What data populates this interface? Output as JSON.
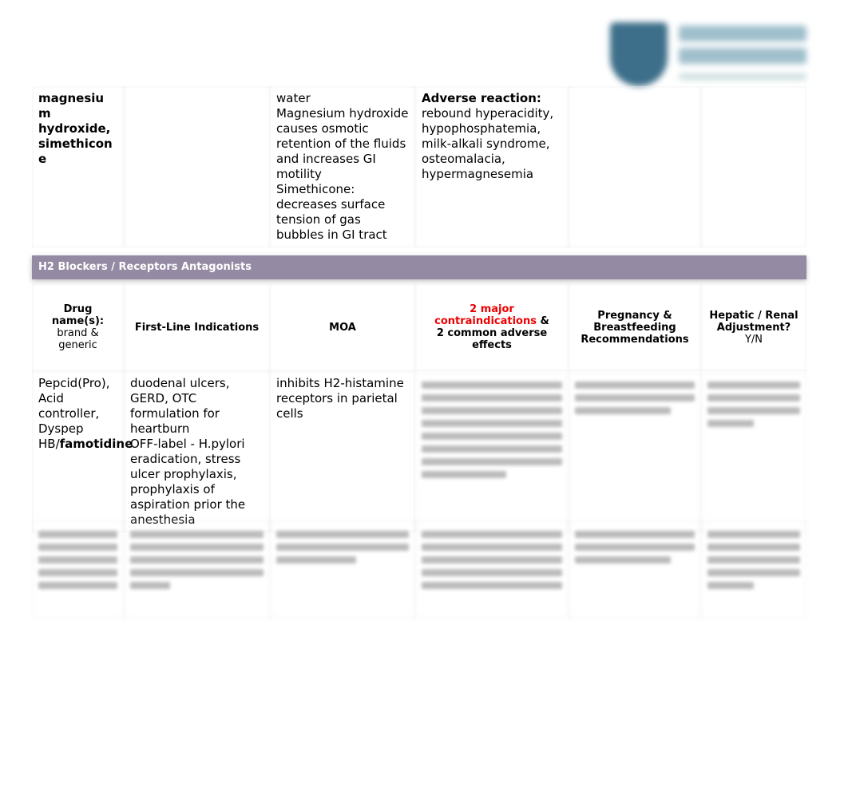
{
  "logo": {
    "icon": "shield-logo",
    "color": "#3d6f8a"
  },
  "row_top": {
    "drug": [
      "magnesiu",
      "m",
      "hydroxide,",
      "simethicon",
      "e"
    ],
    "moa": "water\nMagnesium hydroxide causes osmotic retention of the fluids and increases GI motility\nSimethicone: decreases surface tension of gas bubbles in GI  tract",
    "adverse_label": "Adverse reaction:",
    "adverse": "rebound hyperacidity, hypophosphatemia, milk-alkali syndrome, osteomalacia, hypermagnesemia"
  },
  "section": {
    "title": "H2 Blockers / Receptors Antagonists",
    "color": "#958aa3"
  },
  "headers": {
    "drug_bold": "Drug name(s):",
    "drug_sub": "brand & generic",
    "indications": "First-Line Indications",
    "moa": "MOA",
    "contra_red": "2 major contraindications",
    "contra_amp": " &",
    "contra_rest": "2 common adverse effects",
    "pregnancy": "Pregnancy & Breastfeeding Recommendations",
    "hepatic_bold": "Hepatic / Renal Adjustment?",
    "hepatic_sub": "Y/N"
  },
  "row_pepcid": {
    "drug_plain": "Pepcid(Pro), Acid controller, Dyspep HB/",
    "drug_bold": "famotidine",
    "indications": "duodenal ulcers, GERD, OTC formulation for heartburn\nOFF-label - H.pylori eradication, stress ulcer prophylaxis, prophylaxis of aspiration prior the anesthesia",
    "moa": "inhibits H2-histamine receptors in parietal cells"
  }
}
